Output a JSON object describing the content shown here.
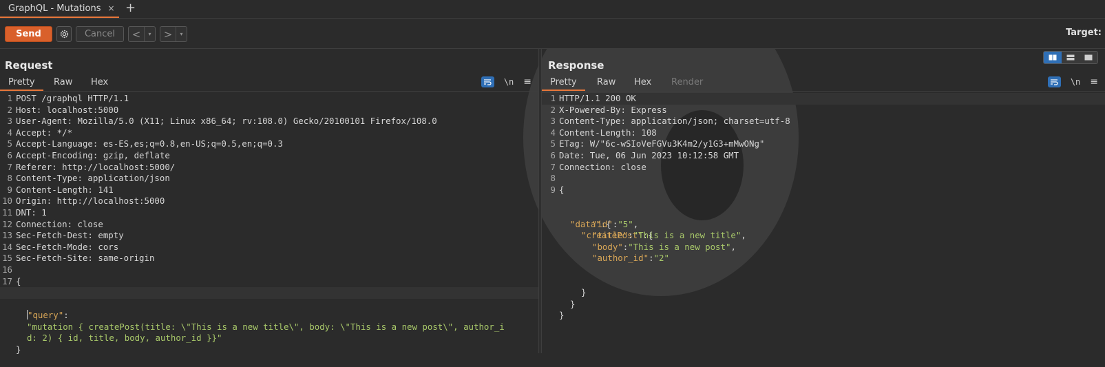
{
  "tab": {
    "title": "GraphQL - Mutations",
    "close": "×",
    "new": "+"
  },
  "toolbar": {
    "send": "Send",
    "cancel": "Cancel",
    "prev": "<",
    "next": ">",
    "dropdown": "▾",
    "target": "Target:"
  },
  "request": {
    "title": "Request",
    "tabs": [
      "Pretty",
      "Raw",
      "Hex"
    ],
    "tools": {
      "newline": "\\n",
      "menu": "≡"
    },
    "lines": [
      {
        "n": "1",
        "text": "POST /graphql HTTP/1.1"
      },
      {
        "n": "2",
        "text": "Host: localhost:5000"
      },
      {
        "n": "3",
        "text": "User-Agent: Mozilla/5.0 (X11; Linux x86_64; rv:108.0) Gecko/20100101 Firefox/108.0"
      },
      {
        "n": "4",
        "text": "Accept: */*"
      },
      {
        "n": "5",
        "text": "Accept-Language: es-ES,es;q=0.8,en-US;q=0.5,en;q=0.3"
      },
      {
        "n": "6",
        "text": "Accept-Encoding: gzip, deflate"
      },
      {
        "n": "7",
        "text": "Referer: http://localhost:5000/"
      },
      {
        "n": "8",
        "text": "Content-Type: application/json"
      },
      {
        "n": "9",
        "text": "Content-Length: 141"
      },
      {
        "n": "10",
        "text": "Origin: http://localhost:5000"
      },
      {
        "n": "11",
        "text": "DNT: 1"
      },
      {
        "n": "12",
        "text": "Connection: close"
      },
      {
        "n": "13",
        "text": "Sec-Fetch-Dest: empty"
      },
      {
        "n": "14",
        "text": "Sec-Fetch-Mode: cors"
      },
      {
        "n": "15",
        "text": "Sec-Fetch-Site: same-origin"
      },
      {
        "n": "16",
        "text": ""
      },
      {
        "n": "17",
        "text": "{"
      }
    ],
    "body": {
      "key": "\"query\"",
      "colon": ":",
      "value_line1": "\"mutation { createPost(title: \\\"This is a new title\\\", body: \\\"This is a new post\\\", author_i",
      "value_line2": "d: 2) { id, title, body, author_id }}\"",
      "close": "}"
    }
  },
  "response": {
    "title": "Response",
    "tabs": [
      "Pretty",
      "Raw",
      "Hex",
      "Render"
    ],
    "tools": {
      "newline": "\\n",
      "menu": "≡"
    },
    "lines": [
      {
        "n": "1",
        "text": "HTTP/1.1 200 OK"
      },
      {
        "n": "2",
        "text": "X-Powered-By: Express"
      },
      {
        "n": "3",
        "text": "Content-Type: application/json; charset=utf-8"
      },
      {
        "n": "4",
        "text": "Content-Length: 108"
      },
      {
        "n": "5",
        "text": "ETag: W/\"6c-wSIoVeFGVu3K4m2/y1G3+mMwONg\""
      },
      {
        "n": "6",
        "text": "Date: Tue, 06 Jun 2023 10:12:58 GMT"
      },
      {
        "n": "7",
        "text": "Connection: close"
      },
      {
        "n": "8",
        "text": ""
      },
      {
        "n": "9",
        "text": "{"
      }
    ],
    "json": {
      "data_key": "\"data\"",
      "createPost_key": "\"createPost\"",
      "fields": [
        {
          "key": "\"id\"",
          "value": "\"5\"",
          "sep": ","
        },
        {
          "key": "\"title\"",
          "value": "\"This is a new title\"",
          "sep": ","
        },
        {
          "key": "\"body\"",
          "value": "\"This is a new post\"",
          "sep": ","
        },
        {
          "key": "\"author_id\"",
          "value": "\"2\"",
          "sep": ""
        }
      ],
      "open": "{",
      "close": "}"
    }
  },
  "colors": {
    "accent": "#e8773a",
    "send": "#d9602b",
    "key": "#d8a657",
    "string": "#a9c96a",
    "selected": "#2f6fb6"
  }
}
